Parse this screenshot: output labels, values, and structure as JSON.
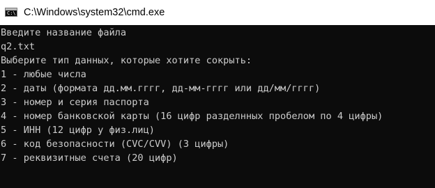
{
  "window": {
    "title": "C:\\Windows\\system32\\cmd.exe",
    "icon": "cmd-icon"
  },
  "console": {
    "lines": [
      "Введите название файла",
      "q2.txt",
      "Выберите тип данных, которые хотите сокрыть:",
      "1 - любые числа",
      "2 - даты (формата дд.мм.гггг, дд-мм-гггг или дд/мм/гггг)",
      "3 - номер и серия паспорта",
      "4 - номер банковской карты (16 цифр разделнных пробелом по 4 цифры)",
      "5 - ИНН (12 цифр у физ.лиц)",
      "6 - код безопасности (CVC/CVV) (3 цифры)",
      "7 - реквизитные счета (20 цифр)"
    ]
  }
}
